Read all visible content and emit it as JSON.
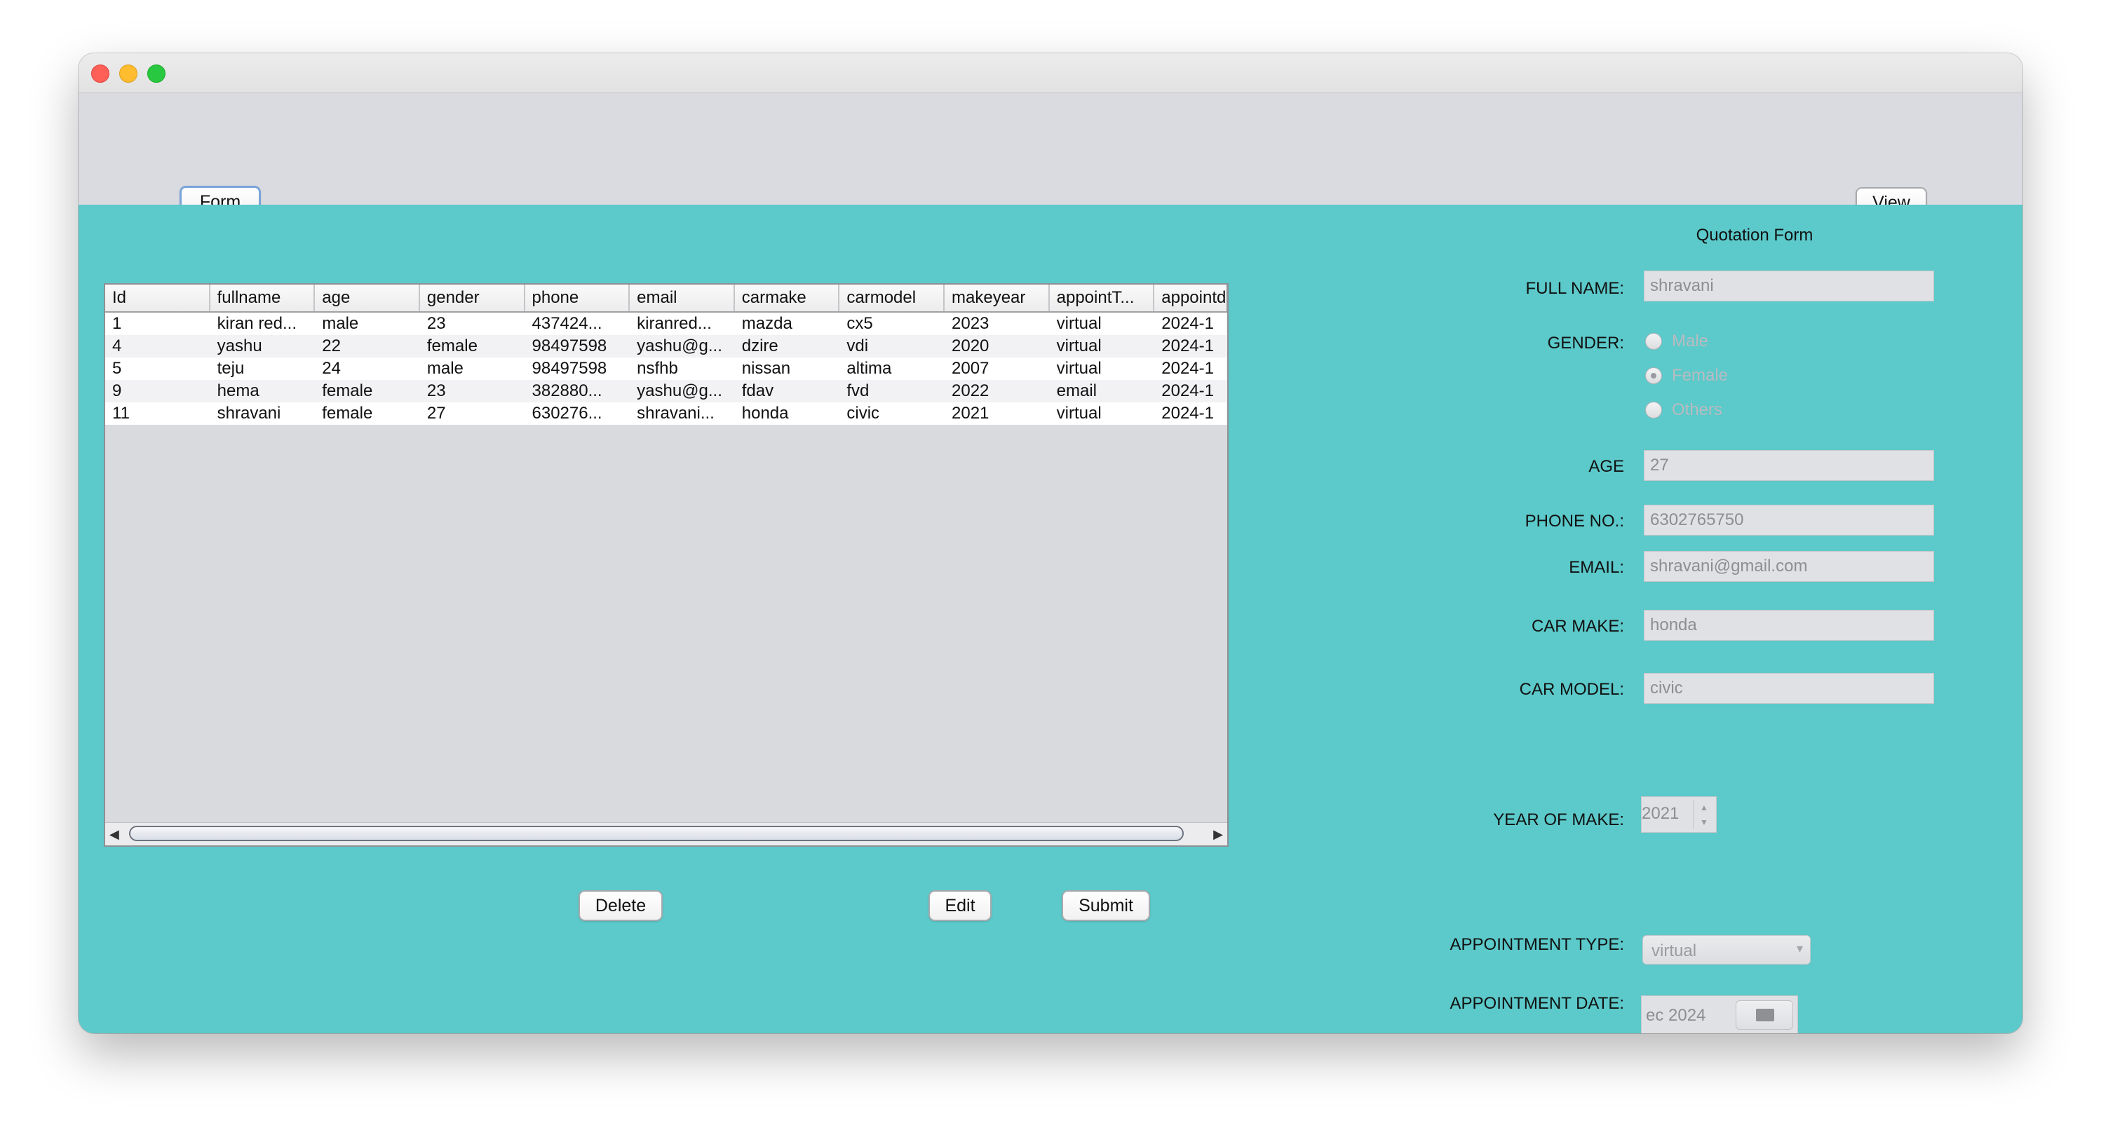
{
  "toolbar": {
    "form_label": "Form",
    "view_label": "View"
  },
  "table": {
    "columns": [
      "Id",
      "fullname",
      "age",
      "gender",
      "phone",
      "email",
      "carmake",
      "carmodel",
      "makeyear",
      "appointT...",
      "appointd"
    ],
    "rows": [
      [
        "1",
        "kiran red...",
        "male",
        "23",
        "437424...",
        "kiranred...",
        "mazda",
        "cx5",
        "2023",
        "virtual",
        "2024-1"
      ],
      [
        "4",
        "yashu",
        "22",
        "female",
        "98497598",
        "yashu@g...",
        "dzire",
        "vdi",
        "2020",
        "virtual",
        "2024-1"
      ],
      [
        "5",
        "teju",
        "24",
        "male",
        "98497598",
        "nsfhb",
        "nissan",
        "altima",
        "2007",
        "virtual",
        "2024-1"
      ],
      [
        "9",
        "hema",
        "female",
        "23",
        "382880...",
        "yashu@g...",
        "fdav",
        "fvd",
        "2022",
        "email",
        "2024-1"
      ],
      [
        "11",
        "shravani",
        "female",
        "27",
        "630276...",
        "shravani...",
        "honda",
        "civic",
        "2021",
        "virtual",
        "2024-1"
      ]
    ]
  },
  "actions": {
    "delete_label": "Delete",
    "edit_label": "Edit",
    "submit_label": "Submit"
  },
  "form": {
    "title": "Quotation Form",
    "full_name_label": "FULL NAME:",
    "full_name_value": "shravani",
    "gender_label": "GENDER:",
    "gender_options": [
      "Male",
      "Female",
      "Others"
    ],
    "gender_selected": "Female",
    "age_label": "AGE",
    "age_value": "27",
    "phone_label": "PHONE NO.:",
    "phone_value": "6302765750",
    "email_label": "EMAIL:",
    "email_value": "shravani@gmail.com",
    "car_make_label": "CAR MAKE:",
    "car_make_value": "honda",
    "car_model_label": "CAR MODEL:",
    "car_model_value": "civic",
    "year_label": "YEAR OF MAKE:",
    "year_value": "2021",
    "appt_type_label": "APPOINTMENT TYPE:",
    "appt_type_value": "virtual",
    "appt_date_label": "APPOINTMENT DATE:",
    "appt_date_value": "ec 2024"
  },
  "colors": {
    "content_bg": "#5cc9ca",
    "toolbar_bg": "#dadbe0",
    "focus_ring": "#7aa4d9"
  }
}
